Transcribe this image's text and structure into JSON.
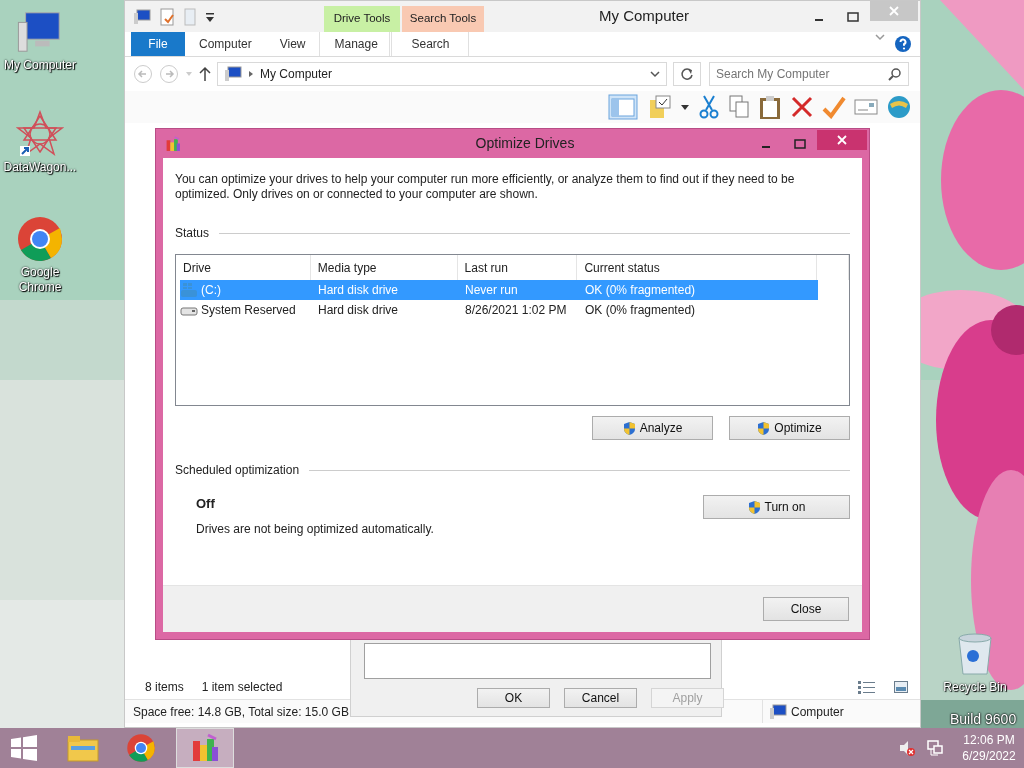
{
  "desktop_icons": [
    {
      "label": "My Computer",
      "kind": "computer"
    },
    {
      "label": "DataWagon...",
      "kind": "star"
    },
    {
      "label": "Google Chrome",
      "kind": "chrome"
    },
    {
      "label": "Recycle Bin",
      "kind": "bin"
    }
  ],
  "os_build_text": "Build 9600",
  "explorer": {
    "title": "My Computer",
    "contextual_tabs": [
      {
        "label": "Drive Tools",
        "color": "#c8f0a4"
      },
      {
        "label": "Search Tools",
        "color": "#f9c9b2"
      }
    ],
    "ribbon_tabs": [
      {
        "label": "File",
        "kind": "file"
      },
      {
        "label": "Computer",
        "kind": "tab"
      },
      {
        "label": "View",
        "kind": "tab"
      },
      {
        "label": "Manage",
        "kind": "context"
      },
      {
        "label": "Search",
        "kind": "context"
      }
    ],
    "address": "My Computer",
    "search": {
      "placeholder": "Search My Computer"
    },
    "item_count": "8 items",
    "selection": "1 item selected",
    "space": "Space free: 14.8 GB, Total size: 15.0 GB",
    "location": "Computer"
  },
  "properties_dialog": {
    "buttons": [
      {
        "label": "OK",
        "disabled": false
      },
      {
        "label": "Cancel",
        "disabled": false
      },
      {
        "label": "Apply",
        "disabled": true
      }
    ]
  },
  "optimize_dialog": {
    "title": "Optimize Drives",
    "intro": "You can optimize your drives to help your computer run more efficiently, or analyze them to find out if they need to be optimized. Only drives on or connected to your computer are shown.",
    "status_heading": "Status",
    "columns": [
      "Drive",
      "Media type",
      "Last run",
      "Current status"
    ],
    "rows": [
      {
        "drive": "(C:)",
        "kind": "system",
        "media": "Hard disk drive",
        "last_run": "Never run",
        "status": "OK (0% fragmented)",
        "selected": true
      },
      {
        "drive": "System Reserved",
        "kind": "plain",
        "media": "Hard disk drive",
        "last_run": "8/26/2021 1:02 PM",
        "status": "OK (0% fragmented)",
        "selected": false
      }
    ],
    "actions": [
      "Analyze",
      "Optimize"
    ],
    "schedule_heading": "Scheduled optimization",
    "schedule_state": "Off",
    "schedule_text": "Drives are not being optimized automatically.",
    "schedule_button": "Turn on",
    "close_button": "Close"
  },
  "taskbar": {
    "apps": [
      {
        "kind": "explorer",
        "active": false
      },
      {
        "kind": "chrome",
        "active": false
      },
      {
        "kind": "defrag",
        "active": true
      }
    ],
    "time": "12:06 PM",
    "date": "6/29/2022"
  }
}
